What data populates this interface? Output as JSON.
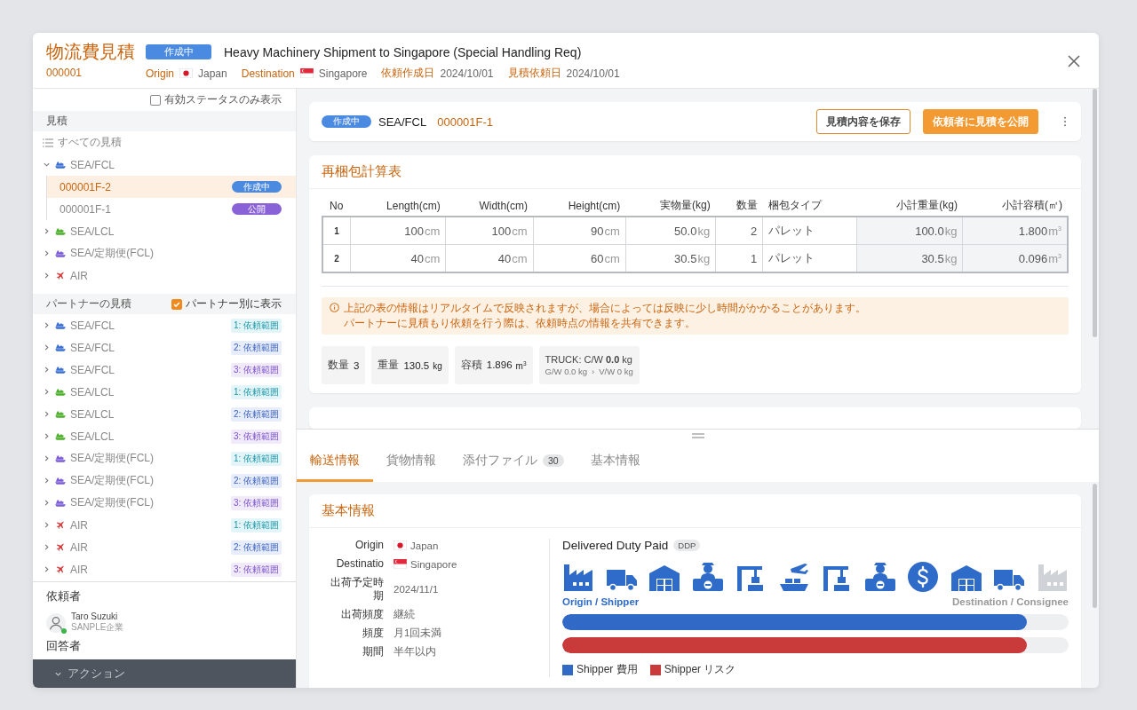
{
  "header": {
    "title": "物流費見積",
    "id": "000001",
    "status": "作成中",
    "subject": "Heavy Machinery Shipment to Singapore (Special Handling Req)",
    "meta": [
      {
        "label": "Origin",
        "kind": "japan",
        "value": "Japan"
      },
      {
        "label": "Destination",
        "kind": "singapore",
        "value": "Singapore"
      },
      {
        "label": "依頼作成日",
        "kind": "plain",
        "value": "2024/10/01"
      },
      {
        "label": "見積依頼日",
        "kind": "plain",
        "value": "2024/10/01"
      }
    ]
  },
  "sidebar": {
    "filter": {
      "label": "有効ステータスのみ表示",
      "checked": false
    },
    "estimates": {
      "title": "見積",
      "all_label": "すべての見積",
      "groups": [
        {
          "label": "SEA/FCL",
          "kind": "ship",
          "color": "#3b6fd1",
          "expanded": true,
          "children": [
            {
              "label": "000001F-2",
              "selected": true,
              "status": "作成中",
              "kind": "draft"
            },
            {
              "label": "000001F-1",
              "selected": false,
              "status": "公開",
              "kind": "published"
            }
          ]
        },
        {
          "label": "SEA/LCL",
          "kind": "ship",
          "color": "#4caf2a",
          "expanded": false
        },
        {
          "label": "SEA/定期便(FCL)",
          "kind": "ship",
          "color": "#7b5bd6",
          "expanded": false
        },
        {
          "label": "AIR",
          "kind": "plane",
          "color": "#d63a3a",
          "expanded": false
        }
      ]
    },
    "partners": {
      "title": "パートナーの見積",
      "toggle": {
        "label": "パートナー別に表示",
        "checked": true
      },
      "items": [
        {
          "label": "SEA/FCL",
          "kind": "ship",
          "color": "#3b6fd1",
          "expanded": false,
          "tag": {
            "text": "1: 依頼範囲",
            "kind": "first"
          }
        },
        {
          "label": "SEA/FCL",
          "kind": "ship",
          "color": "#3b6fd1",
          "expanded": false,
          "tag": {
            "text": "2: 依頼範囲",
            "kind": "second"
          }
        },
        {
          "label": "SEA/FCL",
          "kind": "ship",
          "color": "#3b6fd1",
          "expanded": false,
          "tag": {
            "text": "3: 依頼範囲",
            "kind": "third"
          }
        },
        {
          "label": "SEA/LCL",
          "kind": "ship",
          "color": "#4caf2a",
          "expanded": false,
          "tag": {
            "text": "1: 依頼範囲",
            "kind": "first"
          }
        },
        {
          "label": "SEA/LCL",
          "kind": "ship",
          "color": "#4caf2a",
          "expanded": false,
          "tag": {
            "text": "2: 依頼範囲",
            "kind": "second"
          }
        },
        {
          "label": "SEA/LCL",
          "kind": "ship",
          "color": "#4caf2a",
          "expanded": false,
          "tag": {
            "text": "3: 依頼範囲",
            "kind": "third"
          }
        },
        {
          "label": "SEA/定期便(FCL)",
          "kind": "ship",
          "color": "#7b5bd6",
          "expanded": false,
          "tag": {
            "text": "1: 依頼範囲",
            "kind": "first"
          }
        },
        {
          "label": "SEA/定期便(FCL)",
          "kind": "ship",
          "color": "#7b5bd6",
          "expanded": false,
          "tag": {
            "text": "2: 依頼範囲",
            "kind": "second"
          }
        },
        {
          "label": "SEA/定期便(FCL)",
          "kind": "ship",
          "color": "#7b5bd6",
          "expanded": false,
          "tag": {
            "text": "3: 依頼範囲",
            "kind": "third"
          }
        },
        {
          "label": "AIR",
          "kind": "plane",
          "color": "#d63a3a",
          "expanded": false,
          "tag": {
            "text": "1: 依頼範囲",
            "kind": "first"
          }
        },
        {
          "label": "AIR",
          "kind": "plane",
          "color": "#d63a3a",
          "expanded": false,
          "tag": {
            "text": "2: 依頼範囲",
            "kind": "second"
          }
        },
        {
          "label": "AIR",
          "kind": "plane",
          "color": "#d63a3a",
          "expanded": false,
          "tag": {
            "text": "3: 依頼範囲",
            "kind": "third"
          }
        }
      ]
    },
    "requester": {
      "title": "依頼者",
      "name": "Taro Suzuki",
      "company": "SANPLE企業",
      "online": true
    },
    "responder": {
      "title": "回答者"
    },
    "action_bar": {
      "label": "アクション"
    }
  },
  "quote_card": {
    "status": "作成中",
    "mode": "SEA/FCL",
    "id": "000001F-1",
    "buttons": [
      {
        "label": "見積内容を保存",
        "kind": "outline"
      },
      {
        "label": "依頼者に見積を公開",
        "kind": "primary"
      }
    ]
  },
  "repack": {
    "title": "再梱包計算表",
    "columns": [
      "No",
      "Length(cm)",
      "Width(cm)",
      "Height(cm)",
      "実物量(kg)",
      "数量",
      "梱包タイプ",
      "小計重量(kg)",
      "小計容積(㎥)"
    ],
    "rows": [
      {
        "cells": [
          {
            "value": "1",
            "kind": "no"
          },
          {
            "value": "100",
            "unit": "cm"
          },
          {
            "value": "100",
            "unit": "cm"
          },
          {
            "value": "90",
            "unit": "cm"
          },
          {
            "value": "50.0",
            "unit": "kg"
          },
          {
            "value": "2"
          },
          {
            "value": "パレット",
            "kind": "text"
          },
          {
            "value": "100.0",
            "unit": "kg",
            "kind": "total"
          },
          {
            "value": "1.800",
            "unit": "m$^{3}$",
            "kind": "total"
          }
        ]
      },
      {
        "cells": [
          {
            "value": "2",
            "kind": "no"
          },
          {
            "value": "40",
            "unit": "cm"
          },
          {
            "value": "40",
            "unit": "cm"
          },
          {
            "value": "60",
            "unit": "cm"
          },
          {
            "value": "30.5",
            "unit": "kg"
          },
          {
            "value": "1"
          },
          {
            "value": "パレット",
            "kind": "text"
          },
          {
            "value": "30.5",
            "unit": "kg",
            "kind": "total"
          },
          {
            "value": "0.096",
            "unit": "m$^{3}$",
            "kind": "total"
          }
        ]
      }
    ],
    "notice": [
      "上記の表の情報はリアルタイムで反映されますが、場合によっては反映に少し時間がかかることがあります。",
      "パートナーに見積もり依頼を行う際は、依頼時点の情報を共有できます。"
    ],
    "summary": [
      {
        "label": "数量",
        "value": "3"
      },
      {
        "label": "重量",
        "value": "130.5",
        "unit": "kg"
      },
      {
        "label": "容積",
        "value": "1.896",
        "unit": "m$^{3}$"
      }
    ],
    "truck": {
      "label": "TRUCK:  C/W",
      "value": "0.0",
      "unit": "kg",
      "gross": "G/W 0.0 kg",
      "arrow": "›",
      "volume": "V/W 0 kg"
    }
  },
  "tabs": [
    {
      "label": "輸送情報",
      "selected": true
    },
    {
      "label": "貨物情報",
      "selected": false
    },
    {
      "label": "添付ファイル",
      "count": "30",
      "selected": false
    },
    {
      "label": "基本情報",
      "selected": false
    }
  ],
  "basic_info": {
    "title": "基本情報",
    "fields": [
      {
        "label": "Origin",
        "kind": "japan",
        "value": "Japan"
      },
      {
        "label": "Destinatio",
        "kind": "singapore",
        "value": "Singapore"
      },
      {
        "label": "出荷予定時期",
        "kind": "plain",
        "value": "2024/11/1"
      },
      {
        "label": "出荷頻度",
        "kind": "plain",
        "value": "継続"
      },
      {
        "label": "頻度",
        "kind": "plain",
        "value": "月1回未満"
      },
      {
        "label": "期間",
        "kind": "plain",
        "value": "半年以内"
      }
    ],
    "incoterm": {
      "title": "Delivered Duty Paid",
      "code": "DDP",
      "steps": [
        {
          "kind": "factory",
          "active": true
        },
        {
          "kind": "truck",
          "active": true
        },
        {
          "kind": "warehouse",
          "active": true
        },
        {
          "kind": "customs",
          "active": true
        },
        {
          "kind": "crane",
          "active": true
        },
        {
          "kind": "transport",
          "active": true
        },
        {
          "kind": "crane",
          "active": true
        },
        {
          "kind": "customs",
          "active": true
        },
        {
          "kind": "payment",
          "active": true
        },
        {
          "kind": "warehouse",
          "active": true
        },
        {
          "kind": "truck",
          "active": true
        },
        {
          "kind": "factory",
          "active": false
        }
      ],
      "start_label": "Origin / Shipper",
      "end_label": "Destination / Consignee",
      "bars": [
        {
          "level": 0.918,
          "color": "#3169c6"
        },
        {
          "level": 0.918,
          "color": "#c93a3a"
        }
      ],
      "legend": [
        {
          "label": "Shipper 費用",
          "color": "#3169c6"
        },
        {
          "label": "Shipper リスク",
          "color": "#c93a3a"
        }
      ]
    }
  }
}
